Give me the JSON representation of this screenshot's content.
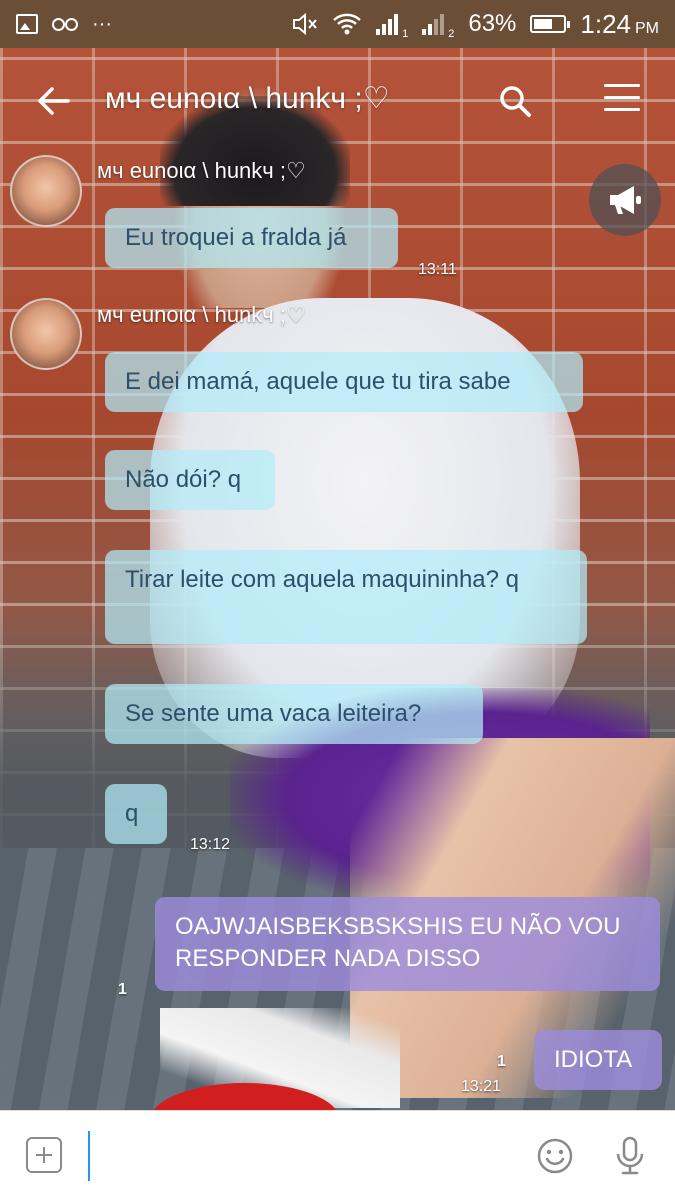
{
  "status_bar": {
    "battery_percent": "63%",
    "battery_level": 0.63,
    "time": "1:24",
    "ampm": "PM",
    "overflow": "···",
    "sim1_label": "1",
    "sim2_label": "2"
  },
  "header": {
    "title": "мч eunoια \\ hunkч ;♡"
  },
  "messages": [
    {
      "id": "m1",
      "sender": "мч eunoια \\ hunkч ;♡",
      "text": "Eu troquei a fralda já",
      "time": "13:11",
      "outgoing": false
    },
    {
      "id": "m2",
      "sender": "мч eunoια \\ hunkч ;♡",
      "text": "E dei mamá, aquele que tu tira sabe",
      "outgoing": false
    },
    {
      "id": "m3",
      "text": "Não dói? q",
      "outgoing": false
    },
    {
      "id": "m4",
      "text": "Tirar leite com aquela maquininha? q",
      "outgoing": false
    },
    {
      "id": "m5",
      "text": "Se sente uma vaca leiteira?",
      "outgoing": false
    },
    {
      "id": "m6",
      "text": "q",
      "time": "13:12",
      "outgoing": false
    },
    {
      "id": "m7",
      "text": "OAJWJAISBEKSBSKSHIS EU NÃO VOU RESPONDER NADA DISSO",
      "read_count": "1",
      "outgoing": true
    },
    {
      "id": "m8",
      "text": "IDIOTA",
      "read_count": "1",
      "time": "13:21",
      "outgoing": true
    }
  ],
  "input": {
    "value": "",
    "placeholder": ""
  },
  "colors": {
    "status_bar": "#6b4e36",
    "incoming_bubble": "#b2ebf8",
    "outgoing_bubble": "#9c8cdc",
    "incoming_text": "#2c4f6b"
  }
}
